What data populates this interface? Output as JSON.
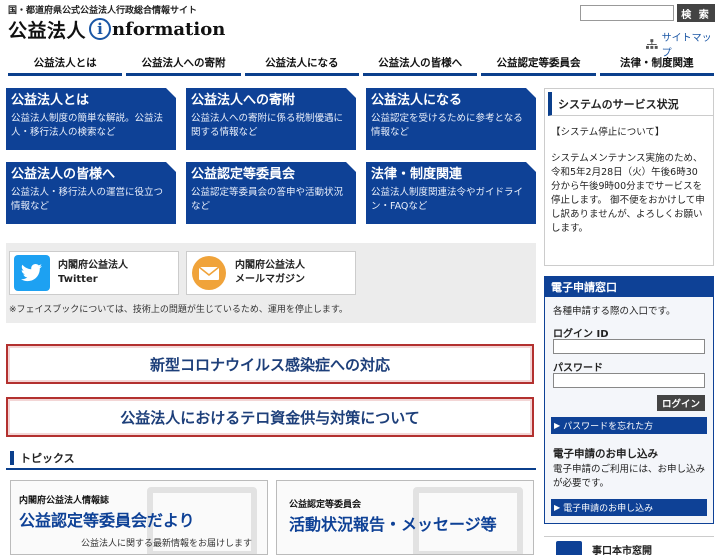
{
  "header": {
    "tagline": "国・都道府県公式公益法人行政総合情報サイト",
    "logo_main": "公益法人",
    "logo_i": "i",
    "logo_rest": "nformation",
    "search_placeholder": "",
    "search_label": "検 索",
    "sitemap_label": "サイトマップ"
  },
  "nav": [
    "公益法人とは",
    "公益法人への寄附",
    "公益法人になる",
    "公益法人の皆様へ",
    "公益認定等委員会",
    "法律・制度関連"
  ],
  "tiles": [
    {
      "title": "公益法人とは",
      "desc": "公益法人制度の簡単な解説。公益法人・移行法人の検索など"
    },
    {
      "title": "公益法人への寄附",
      "desc": "公益法人への寄附に係る税制優遇に関する情報など"
    },
    {
      "title": "公益法人になる",
      "desc": "公益認定を受けるために参考となる情報など"
    },
    {
      "title": "公益法人の皆様へ",
      "desc": "公益法人・移行法人の運営に役立つ情報など"
    },
    {
      "title": "公益認定等委員会",
      "desc": "公益認定等委員会の答申や活動状況など"
    },
    {
      "title": "法律・制度関連",
      "desc": "公益法人制度関連法令やガイドライン・FAQなど"
    }
  ],
  "sns": {
    "twitter_line1": "内閣府公益法人",
    "twitter_line2": "Twitter",
    "mail_line1": "内閣府公益法人",
    "mail_line2": "メールマガジン",
    "note": "※フェイスブックについては、技術上の問題が生じているため、運用を停止します。"
  },
  "banners": {
    "covid": "新型コロナウイルス感染症への対応",
    "terror": "公益法人におけるテロ資金供与対策について"
  },
  "topics": {
    "heading": "トピックス",
    "card1_small": "内閣府公益法人情報誌",
    "card1_big": "公益認定等委員会だより",
    "card1_sub": "公益法人に関する最新情報をお届けします",
    "card2_small": "公益認定等委員会",
    "card2_big": "活動状況報告・メッセージ等"
  },
  "status": {
    "heading": "システムのサービス状況",
    "sub": "【システム停止について】",
    "body": "システムメンテナンス実施のため、令和5年2月28日（火）午後6時30分から午後9時00分までサービスを停止します。 御不便をおかけして申し訳ありませんが、よろしくお願いします。"
  },
  "epanel": {
    "heading": "電子申請窓口",
    "desc": "各種申請する際の入口です。",
    "login_id_label": "ログイン ID",
    "password_label": "パスワード",
    "login_button": "ログイン",
    "forgot_link": "パスワードを忘れた方",
    "apply_heading": "電子申請のお申し込み",
    "apply_desc": "電子申請のご利用には、お申し込みが必要です。",
    "apply_link": "電子申請のお申し込み"
  },
  "bottom_right": {
    "label": "事口本市窓開"
  },
  "colors": {
    "brand_blue": "#0e4196",
    "banner_red": "#b3312f"
  }
}
